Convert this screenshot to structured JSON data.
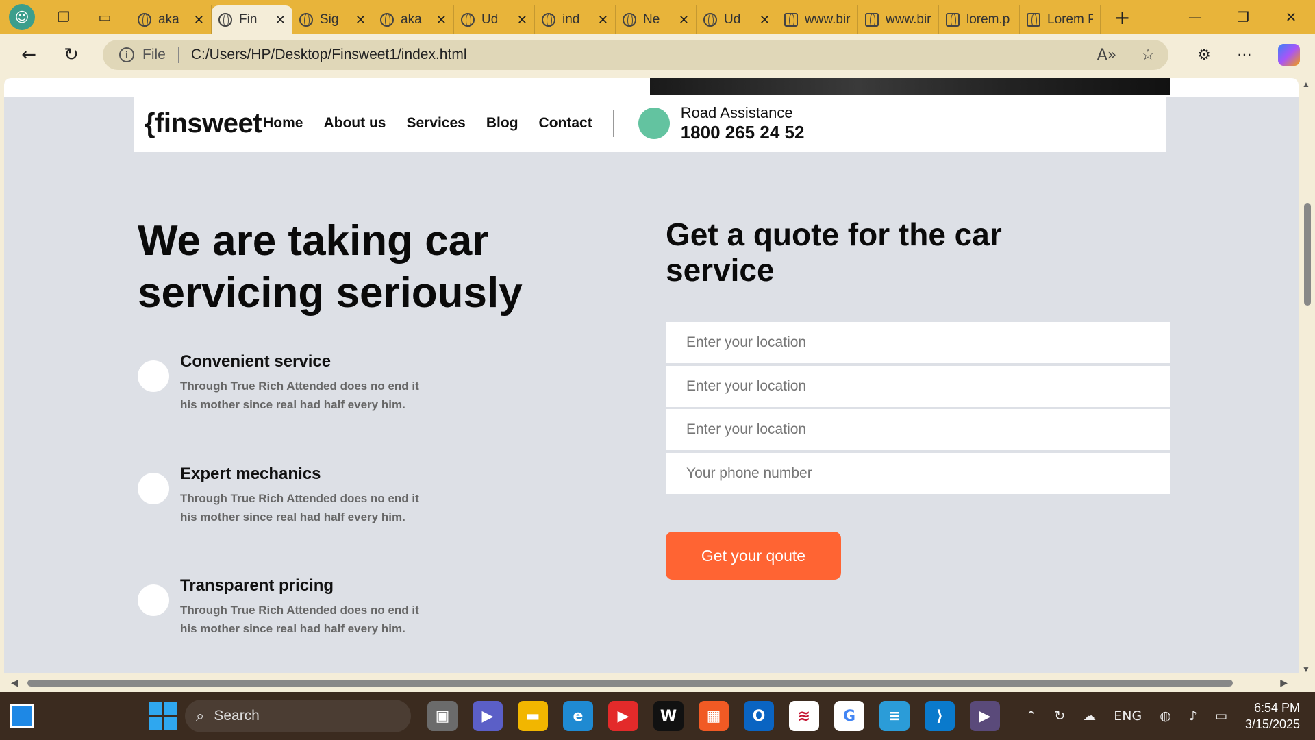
{
  "browser": {
    "tabs": [
      {
        "title": "aka",
        "active": false
      },
      {
        "title": "Fin",
        "active": true
      },
      {
        "title": "Sig",
        "active": false
      },
      {
        "title": "aka",
        "active": false
      },
      {
        "title": "Ud",
        "active": false
      },
      {
        "title": "ind",
        "active": false
      },
      {
        "title": "Ne",
        "active": false
      },
      {
        "title": "Ud",
        "active": false
      },
      {
        "title": "www.bir",
        "active": false
      },
      {
        "title": "www.bir",
        "active": false
      },
      {
        "title": "lorem.p",
        "active": false
      },
      {
        "title": "Lorem P",
        "active": false
      }
    ],
    "address": {
      "scheme_label": "File",
      "url": "C:/Users/HP/Desktop/Finsweet1/index.html"
    },
    "accent_color": "#e8b43a"
  },
  "site": {
    "logo": "{finsweet",
    "nav": [
      "Home",
      "About us",
      "Services",
      "Blog",
      "Contact"
    ],
    "road": {
      "label": "Road Assistance",
      "phone": "1800 265 24 52"
    },
    "hero_title": "We are taking car servicing seriously",
    "features": [
      {
        "title": "Convenient service",
        "desc": "Through True Rich Attended does no end it his mother since real had half every him."
      },
      {
        "title": "Expert mechanics",
        "desc": "Through True Rich Attended does no end it his mother since real had half every him."
      },
      {
        "title": "Transparent pricing",
        "desc": "Through True Rich Attended does no end it his mother since real had half every him."
      }
    ],
    "quote": {
      "title": "Get a quote for the car service",
      "fields": [
        {
          "placeholder": "Enter your location"
        },
        {
          "placeholder": "Enter your location"
        },
        {
          "placeholder": "Enter your location"
        },
        {
          "placeholder": "Your phone number"
        }
      ],
      "button": "Get your qoute"
    },
    "colors": {
      "accent_button": "#ff6433",
      "road_dot": "#63c3a0",
      "page_bg": "#dde0e6"
    }
  },
  "taskbar": {
    "search_label": "Search",
    "language": "ENG",
    "time": "6:54 PM",
    "date": "3/15/2025"
  }
}
